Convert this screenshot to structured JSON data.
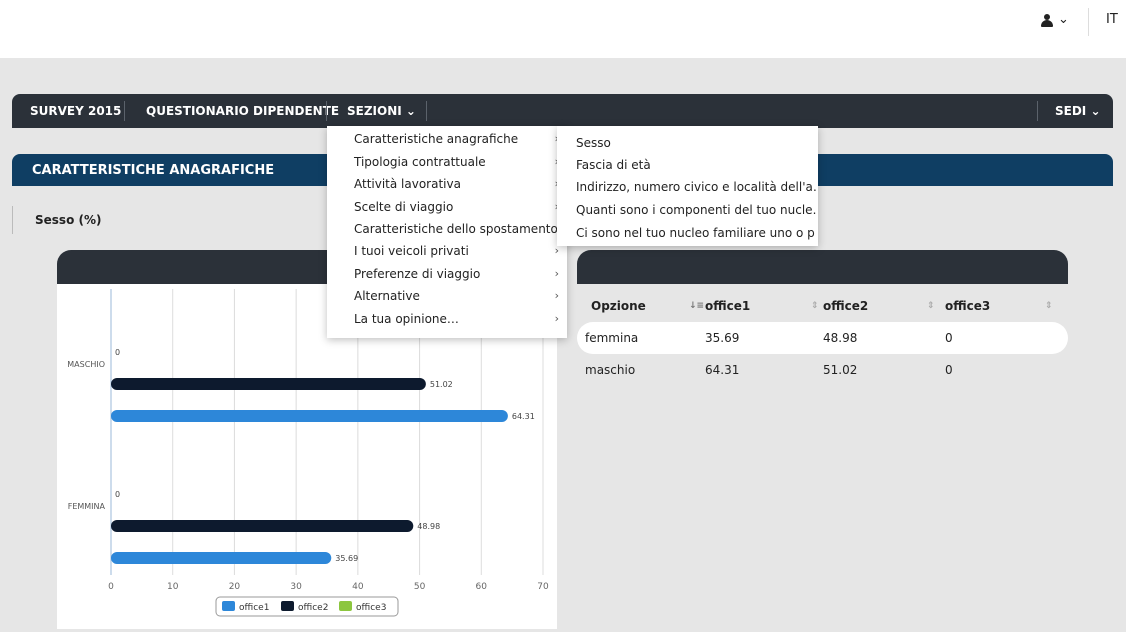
{
  "header": {
    "user_icon": "person-icon",
    "user_caret": "⌄",
    "lang": "IT"
  },
  "nav": {
    "items": [
      "SURVEY 2015",
      "QUESTIONARIO DIPENDENTE",
      "SEZIONI ⌄"
    ],
    "right": "SEDI ⌄"
  },
  "section": {
    "title": "CARATTERISTICHE ANAGRAFICHE"
  },
  "subtab": {
    "label": "Sesso (%)"
  },
  "menu": {
    "items": [
      "Caratteristiche anagrafiche",
      "Tipologia contrattuale",
      "Attività lavorativa",
      "Scelte di viaggio",
      "Caratteristiche dello spostamento",
      "I tuoi veicoli privati",
      "Preferenze di viaggio",
      "Alternative",
      "La tua opinione…"
    ],
    "submenu": [
      "Sesso",
      "Fascia di età",
      "Indirizzo, numero civico e località dell'a…",
      "Quanti sono i componenti del tuo nucle…",
      "Ci sono nel tuo nucleo familiare uno o p…"
    ]
  },
  "table": {
    "headers": [
      "Opzione",
      "office1",
      "office2",
      "office3"
    ],
    "rows": [
      [
        "femmina",
        "35.69",
        "48.98",
        "0"
      ],
      [
        "maschio",
        "64.31",
        "51.02",
        "0"
      ]
    ]
  },
  "colors": {
    "office1": "#2d87d9",
    "office2": "#0d1a2e",
    "office3": "#8cc63f",
    "navbar": "#2b3139",
    "section": "#0f3e63"
  },
  "chart_data": {
    "type": "bar",
    "orientation": "horizontal",
    "categories": [
      "MASCHIO",
      "FEMMINA"
    ],
    "series": [
      {
        "name": "office1",
        "values": [
          64.31,
          35.69
        ]
      },
      {
        "name": "office2",
        "values": [
          51.02,
          48.98
        ]
      },
      {
        "name": "office3",
        "values": [
          0,
          0
        ]
      }
    ],
    "xlim": [
      0,
      70
    ],
    "xticks": [
      0,
      10,
      20,
      30,
      40,
      50,
      60,
      70
    ],
    "legend": "bottom",
    "grid": true
  }
}
